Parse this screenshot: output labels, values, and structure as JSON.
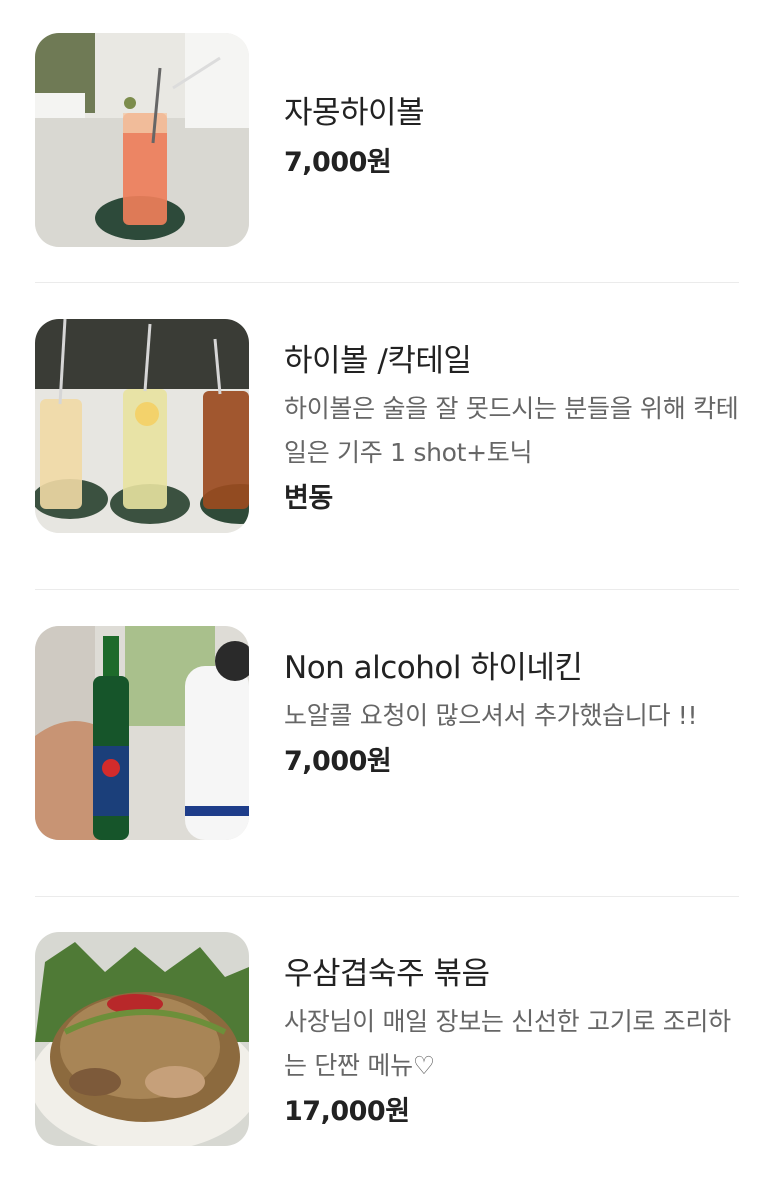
{
  "menu": {
    "items": [
      {
        "name": "자몽하이볼",
        "description": "",
        "price": "7,000원",
        "image_name": "grapefruit-highball-photo"
      },
      {
        "name": "하이볼 /칵테일",
        "description": "하이볼은 술을 잘 못드시는 분들을 위해 칵테일은 기주 1 shot+토닉",
        "price": "변동",
        "image_name": "highball-cocktail-photo"
      },
      {
        "name": "Non alcohol 하이네킨",
        "description": "노알콜 요청이 많으셔서 추가했습니다 !!",
        "price": "7,000원",
        "image_name": "heineken-zero-photo"
      },
      {
        "name": "우삼겹숙주 볶음",
        "description": "사장님이 매일 장보는 신선한 고기로 조리하는 단짠 메뉴♡",
        "price": "17,000원",
        "image_name": "beef-bean-sprout-stir-fry-photo"
      }
    ]
  }
}
